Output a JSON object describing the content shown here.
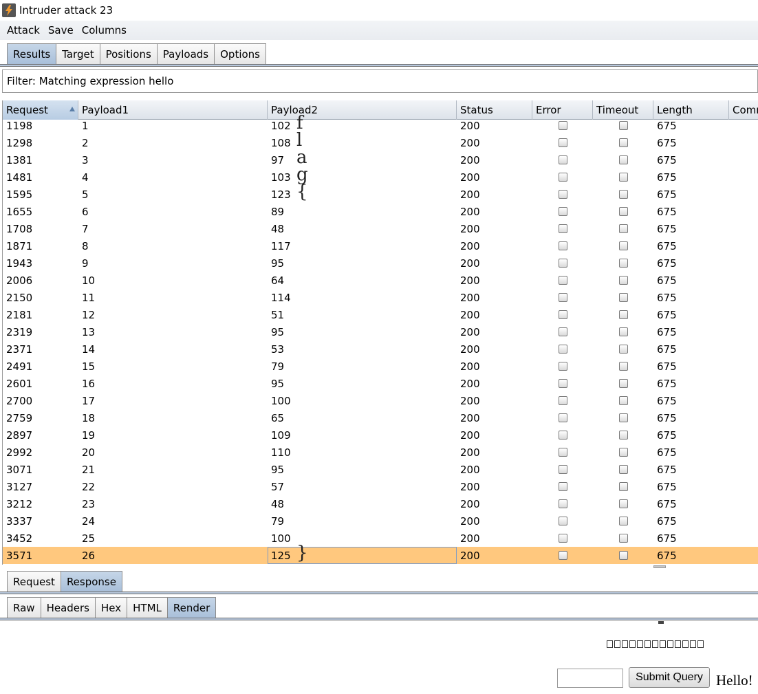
{
  "window": {
    "title": "Intruder attack 23"
  },
  "menu": [
    "Attack",
    "Save",
    "Columns"
  ],
  "main_tabs": [
    "Results",
    "Target",
    "Positions",
    "Payloads",
    "Options"
  ],
  "filter": {
    "text": "Filter: Matching expression hello"
  },
  "table": {
    "columns": [
      "Request",
      "Payload1",
      "Payload2",
      "Status",
      "Error",
      "Timeout",
      "Length",
      "Comm"
    ],
    "sorted_column": "Request",
    "rows": [
      {
        "request": "1198",
        "payload1": "1",
        "payload2": "102",
        "glyph": "f",
        "status": "200",
        "length": "675"
      },
      {
        "request": "1298",
        "payload1": "2",
        "payload2": "108",
        "glyph": "l",
        "status": "200",
        "length": "675"
      },
      {
        "request": "1381",
        "payload1": "3",
        "payload2": "97",
        "glyph": "a",
        "status": "200",
        "length": "675"
      },
      {
        "request": "1481",
        "payload1": "4",
        "payload2": "103",
        "glyph": "g",
        "status": "200",
        "length": "675"
      },
      {
        "request": "1595",
        "payload1": "5",
        "payload2": "123",
        "glyph": "{",
        "status": "200",
        "length": "675"
      },
      {
        "request": "1655",
        "payload1": "6",
        "payload2": "89",
        "glyph": "",
        "status": "200",
        "length": "675"
      },
      {
        "request": "1708",
        "payload1": "7",
        "payload2": "48",
        "glyph": "",
        "status": "200",
        "length": "675"
      },
      {
        "request": "1871",
        "payload1": "8",
        "payload2": "117",
        "glyph": "",
        "status": "200",
        "length": "675"
      },
      {
        "request": "1943",
        "payload1": "9",
        "payload2": "95",
        "glyph": "",
        "status": "200",
        "length": "675"
      },
      {
        "request": "2006",
        "payload1": "10",
        "payload2": "64",
        "glyph": "",
        "status": "200",
        "length": "675"
      },
      {
        "request": "2150",
        "payload1": "11",
        "payload2": "114",
        "glyph": "",
        "status": "200",
        "length": "675"
      },
      {
        "request": "2181",
        "payload1": "12",
        "payload2": "51",
        "glyph": "",
        "status": "200",
        "length": "675"
      },
      {
        "request": "2319",
        "payload1": "13",
        "payload2": "95",
        "glyph": "",
        "status": "200",
        "length": "675"
      },
      {
        "request": "2371",
        "payload1": "14",
        "payload2": "53",
        "glyph": "",
        "status": "200",
        "length": "675"
      },
      {
        "request": "2491",
        "payload1": "15",
        "payload2": "79",
        "glyph": "",
        "status": "200",
        "length": "675"
      },
      {
        "request": "2601",
        "payload1": "16",
        "payload2": "95",
        "glyph": "",
        "status": "200",
        "length": "675"
      },
      {
        "request": "2700",
        "payload1": "17",
        "payload2": "100",
        "glyph": "",
        "status": "200",
        "length": "675"
      },
      {
        "request": "2759",
        "payload1": "18",
        "payload2": "65",
        "glyph": "",
        "status": "200",
        "length": "675"
      },
      {
        "request": "2897",
        "payload1": "19",
        "payload2": "109",
        "glyph": "",
        "status": "200",
        "length": "675"
      },
      {
        "request": "2992",
        "payload1": "20",
        "payload2": "110",
        "glyph": "",
        "status": "200",
        "length": "675"
      },
      {
        "request": "3071",
        "payload1": "21",
        "payload2": "95",
        "glyph": "",
        "status": "200",
        "length": "675"
      },
      {
        "request": "3127",
        "payload1": "22",
        "payload2": "57",
        "glyph": "",
        "status": "200",
        "length": "675"
      },
      {
        "request": "3212",
        "payload1": "23",
        "payload2": "48",
        "glyph": "",
        "status": "200",
        "length": "675"
      },
      {
        "request": "3337",
        "payload1": "24",
        "payload2": "79",
        "glyph": "",
        "status": "200",
        "length": "675"
      },
      {
        "request": "3452",
        "payload1": "25",
        "payload2": "100",
        "glyph": "",
        "status": "200",
        "length": "675"
      },
      {
        "request": "3571",
        "payload1": "26",
        "payload2": "125",
        "glyph": "}",
        "status": "200",
        "length": "675",
        "selected": true
      }
    ]
  },
  "viewer_tabs": [
    "Request",
    "Response"
  ],
  "response_tabs": [
    "Raw",
    "Headers",
    "Hex",
    "HTML",
    "Render"
  ],
  "render": {
    "placeholder_box_count": 13,
    "submit_label": "Submit Query",
    "hello_text": "Hello!"
  }
}
